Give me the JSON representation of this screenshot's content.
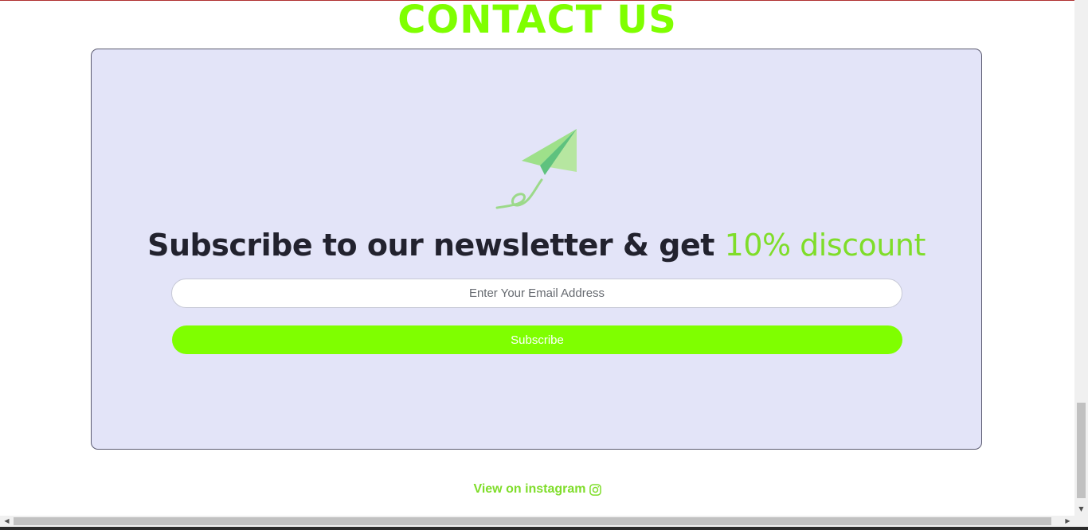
{
  "section": {
    "title": "CONTACT US"
  },
  "newsletter": {
    "headline_main": "Subscribe to our newsletter & get ",
    "headline_accent": "10% discount",
    "email_placeholder": "Enter Your Email Address",
    "email_value": "",
    "subscribe_label": "Subscribe",
    "icon": "paper-plane-icon"
  },
  "footer": {
    "instagram_label": "View on instagram",
    "instagram_icon": "instagram-icon"
  },
  "colors": {
    "accent": "#7fff00",
    "card_bg": "#e3e4f8",
    "headline": "#22222e"
  }
}
